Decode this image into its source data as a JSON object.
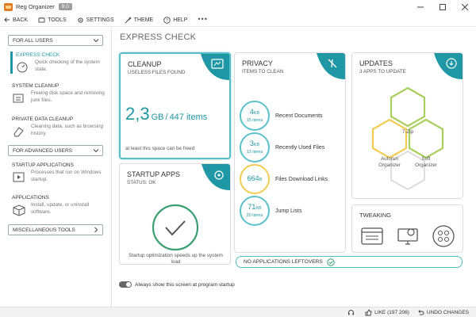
{
  "window": {
    "title": "Reg Organizer",
    "version": "9.0"
  },
  "toolbar": {
    "back": "BACK",
    "tools": "TOOLS",
    "settings": "SETTINGS",
    "theme": "THEME",
    "help": "HELP",
    "more": "•••"
  },
  "sidebar": {
    "all_users": "FOR ALL USERS",
    "advanced_users": "FOR ADVANCED USERS",
    "misc_tools": "MISCELLANEOUS TOOLS",
    "items": [
      {
        "title": "EXPRESS CHECK",
        "desc": "Quick checking of the system state."
      },
      {
        "title": "SYSTEM CLEANUP",
        "desc": "Freeing disk space and removing junk files."
      },
      {
        "title": "PRIVATE DATA CLEANUP",
        "desc": "Cleaning data, such as browsing history."
      },
      {
        "title": "STARTUP APPLICATIONS",
        "desc": "Processes that run on Windows startup."
      },
      {
        "title": "APPLICATIONS",
        "desc": "Install, update, or uninstall software."
      }
    ]
  },
  "main": {
    "title": "EXPRESS CHECK",
    "cleanup": {
      "title": "CLEANUP",
      "subtitle": "USELESS FILES FOUND",
      "value": "2,3",
      "unit": "GB",
      "separator": "/",
      "items": "447 items",
      "footer": "at least this space can be freed"
    },
    "startup": {
      "title": "STARTUP APPS",
      "subtitle": "STATUS: OK",
      "footer": "Startup optimization speeds up the system load"
    },
    "privacy": {
      "title": "PRIVACY",
      "subtitle": "ITEMS TO CLEAN",
      "rows": [
        {
          "value": "4",
          "unit": "KB",
          "sub": "15 items",
          "label": "Recent Documents"
        },
        {
          "value": "3",
          "unit": "KB",
          "sub": "13 items",
          "label": "Recently Used Files"
        },
        {
          "value": "664",
          "unit": "B",
          "sub": "",
          "label": "Files Download Links"
        },
        {
          "value": "71",
          "unit": "KB",
          "sub": "20 items",
          "label": "Jump Lists"
        }
      ]
    },
    "updates": {
      "title": "UPDATES",
      "subtitle": "3 APPS TO UPDATE",
      "apps": [
        "7-Zip",
        "Autorun Organizer",
        "Soft Organizer"
      ]
    },
    "tweaking": {
      "title": "TWEAKING"
    },
    "leftovers": "NO APPLICATIONS LEFTOVERS",
    "startup_toggle": "Always show this screen at program startup"
  },
  "statusbar": {
    "like": "LIKE (197 206)",
    "undo": "UNDO CHANGES"
  },
  "colors": {
    "accent": "#1f97a4",
    "ring_teal": "#5bc2cc",
    "ring_gold": "#f2cb53",
    "hex_green": "#a8cf5c"
  }
}
